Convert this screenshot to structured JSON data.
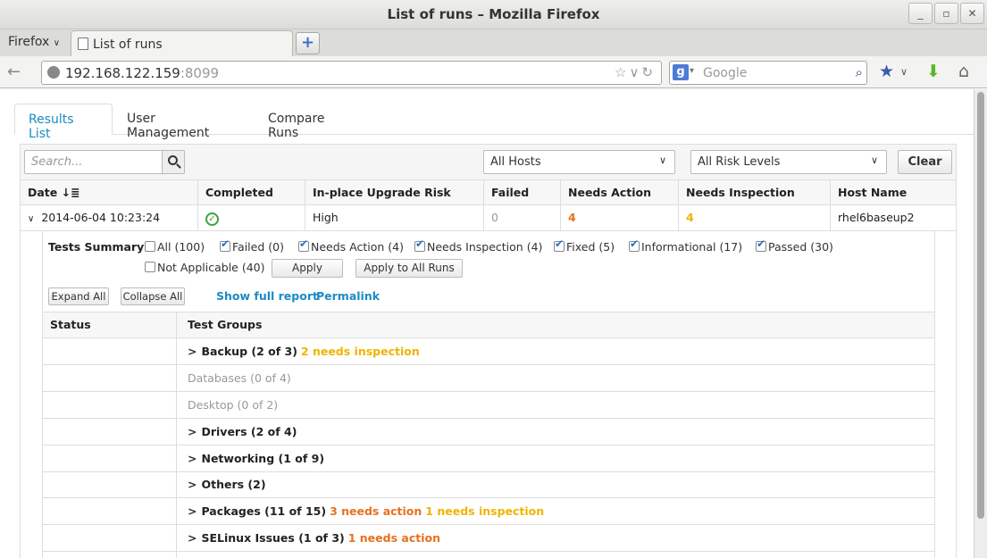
{
  "window": {
    "title": "List of runs – Mozilla Firefox"
  },
  "browser": {
    "menu_label": "Firefox",
    "tab_title": "List of runs",
    "new_tab_glyph": "+",
    "url_host": "192.168.122.159",
    "url_port": ":8099",
    "search_engine": "g",
    "search_placeholder": "Google"
  },
  "app": {
    "tabs": [
      "Results List",
      "User Management",
      "Compare Runs"
    ],
    "active_tab": "Results List",
    "filter": {
      "search_placeholder": "Search...",
      "host_select": "All Hosts",
      "risk_select": "All Risk Levels",
      "clear_label": "Clear"
    },
    "columns": [
      "Date",
      "Completed",
      "In-place Upgrade Risk",
      "Failed",
      "Needs Action",
      "Needs Inspection",
      "Host Name"
    ],
    "run": {
      "date": "2014-06-04 10:23:24",
      "completed": true,
      "risk": "High",
      "failed": "0",
      "needs_action": "4",
      "needs_inspection": "4",
      "host": "rhel6baseup2"
    },
    "summary": {
      "label": "Tests Summary:",
      "filters": [
        {
          "label": "All (100)",
          "checked": false
        },
        {
          "label": "Failed (0)",
          "checked": true
        },
        {
          "label": "Needs Action (4)",
          "checked": true
        },
        {
          "label": "Needs Inspection (4)",
          "checked": true
        },
        {
          "label": "Fixed (5)",
          "checked": true
        },
        {
          "label": "Informational (17)",
          "checked": true
        },
        {
          "label": "Passed (30)",
          "checked": true
        },
        {
          "label": "Not Applicable (40)",
          "checked": false
        }
      ],
      "apply_label": "Apply",
      "apply_all_label": "Apply to All Runs",
      "expand_all_label": "Expand All",
      "collapse_all_label": "Collapse All",
      "show_report_label": "Show full report",
      "permalink_label": "Permalink"
    },
    "groups_header": {
      "status": "Status",
      "groups": "Test Groups"
    },
    "groups": [
      {
        "name": "Backup (2 of 3)",
        "action": "",
        "inspection": "2 needs inspection",
        "expandable": true
      },
      {
        "name": "Databases (0 of 4)",
        "action": "",
        "inspection": "",
        "expandable": false
      },
      {
        "name": "Desktop (0 of 2)",
        "action": "",
        "inspection": "",
        "expandable": false
      },
      {
        "name": "Drivers (2 of 4)",
        "action": "",
        "inspection": "",
        "expandable": true
      },
      {
        "name": "Networking (1 of 9)",
        "action": "",
        "inspection": "",
        "expandable": true
      },
      {
        "name": "Others (2)",
        "action": "",
        "inspection": "",
        "expandable": true
      },
      {
        "name": "Packages (11 of 15)",
        "action": "3 needs action",
        "inspection": "1 needs inspection",
        "expandable": true
      },
      {
        "name": "SELinux Issues (1 of 3)",
        "action": "1 needs action",
        "inspection": "",
        "expandable": true
      }
    ]
  },
  "colors": {
    "link": "#1b8bc3",
    "needs_action": "#e8711c",
    "needs_inspection": "#f0b400",
    "completed_ok": "#3aa43a"
  }
}
